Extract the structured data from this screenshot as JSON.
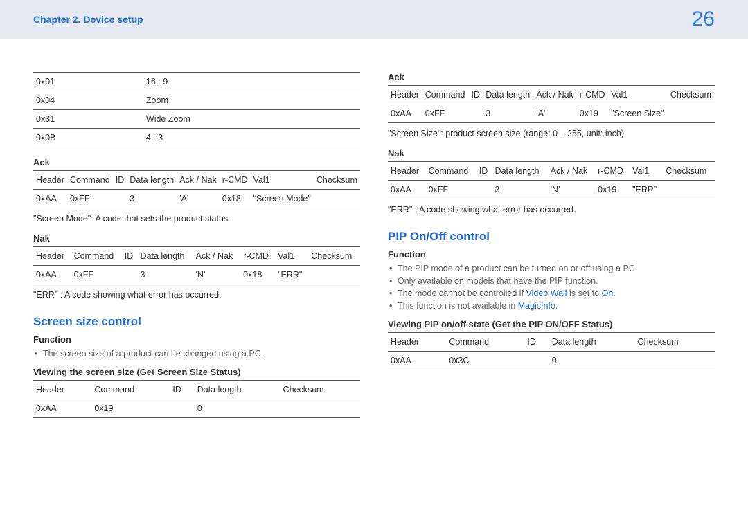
{
  "header": {
    "breadcrumb": "Chapter 2. Device setup",
    "page_number": "26"
  },
  "left": {
    "codes_table": [
      [
        "0x01",
        "16 : 9"
      ],
      [
        "0x04",
        "Zoom"
      ],
      [
        "0x31",
        "Wide Zoom"
      ],
      [
        "0x0B",
        "4 : 3"
      ]
    ],
    "ack_label": "Ack",
    "cmd_headers": [
      "Header",
      "Command",
      "ID",
      "Data length",
      "Ack / Nak",
      "r-CMD",
      "Val1",
      "Checksum"
    ],
    "ack_row": [
      "0xAA",
      "0xFF",
      "",
      "3",
      "'A'",
      "0x18",
      "\"Screen Mode\"",
      ""
    ],
    "screen_mode_note": "\"Screen Mode\": A code that sets the product status",
    "nak_label": "Nak",
    "nak_row": [
      "0xAA",
      "0xFF",
      "",
      "3",
      "'N'",
      "0x18",
      "\"ERR\"",
      ""
    ],
    "err_note": "\"ERR\" : A code showing what error has occurred.",
    "section_title": "Screen size control",
    "func_label": "Function",
    "func_bullet": "The screen size of a product can be changed using a PC.",
    "viewing_label": "Viewing the screen size (Get Screen Size Status)",
    "view_headers": [
      "Header",
      "Command",
      "ID",
      "Data length",
      "Checksum"
    ],
    "view_row": [
      "0xAA",
      "0x19",
      "",
      "0",
      ""
    ]
  },
  "right": {
    "ack_label": "Ack",
    "cmd_headers": [
      "Header",
      "Command",
      "ID",
      "Data length",
      "Ack / Nak",
      "r-CMD",
      "Val1",
      "Checksum"
    ],
    "ack_row": [
      "0xAA",
      "0xFF",
      "",
      "3",
      "'A'",
      "0x19",
      "\"Screen Size\"",
      ""
    ],
    "size_note": "\"Screen Size\": product screen size (range: 0 – 255, unit: inch)",
    "nak_label": "Nak",
    "nak_row": [
      "0xAA",
      "0xFF",
      "",
      "3",
      "'N'",
      "0x19",
      "\"ERR\"",
      ""
    ],
    "err_note": "\"ERR\" : A code showing what error has occurred.",
    "section_title": "PIP On/Off control",
    "func_label": "Function",
    "bullets": {
      "b1": "The PIP mode of a product can be turned on or off using a PC.",
      "b2": "Only available on models that have the PIP function.",
      "b3_pre": "The mode cannot be controlled if ",
      "b3_hl1": "Video Wall",
      "b3_mid": " is set to ",
      "b3_hl2": "On",
      "b3_post": ".",
      "b4_pre": "This function is not available in ",
      "b4_hl": "MagicInfo",
      "b4_post": "."
    },
    "viewing_label": "Viewing PIP on/off state (Get the PIP ON/OFF Status)",
    "view_headers": [
      "Header",
      "Command",
      "ID",
      "Data length",
      "Checksum"
    ],
    "view_row": [
      "0xAA",
      "0x3C",
      "",
      "0",
      ""
    ]
  }
}
